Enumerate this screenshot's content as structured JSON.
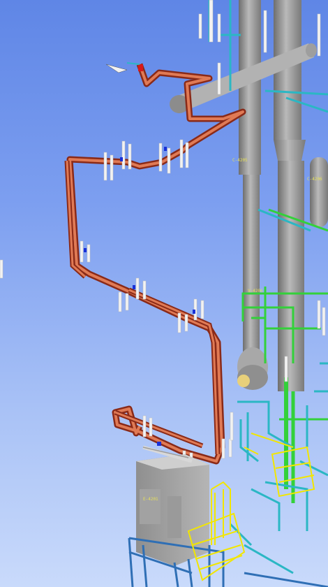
{
  "viewer": {
    "background_top": "#5f86e6",
    "background_bottom": "#c9dafb"
  },
  "model": {
    "colors": {
      "heat_traced_pipe": "#c8452a",
      "pipe_jacket": "#e07a55",
      "process_pipe_cyan": "#2bb7c4",
      "process_pipe_green": "#33d13a",
      "vessel_grey": "#9a9a9a",
      "pipe_support": "#f2f2f2",
      "structural_steel": "#2f6fb5",
      "ladder_yellow": "#f2e600",
      "valve_blue": "#1830d8",
      "valve_red": "#d81818",
      "label_yellow": "#e6e05a"
    },
    "equipment_tags": {
      "column_a": "C-4205",
      "column_b": "C-4206",
      "drum": "V-4206",
      "box_unit": "E-4201"
    }
  }
}
